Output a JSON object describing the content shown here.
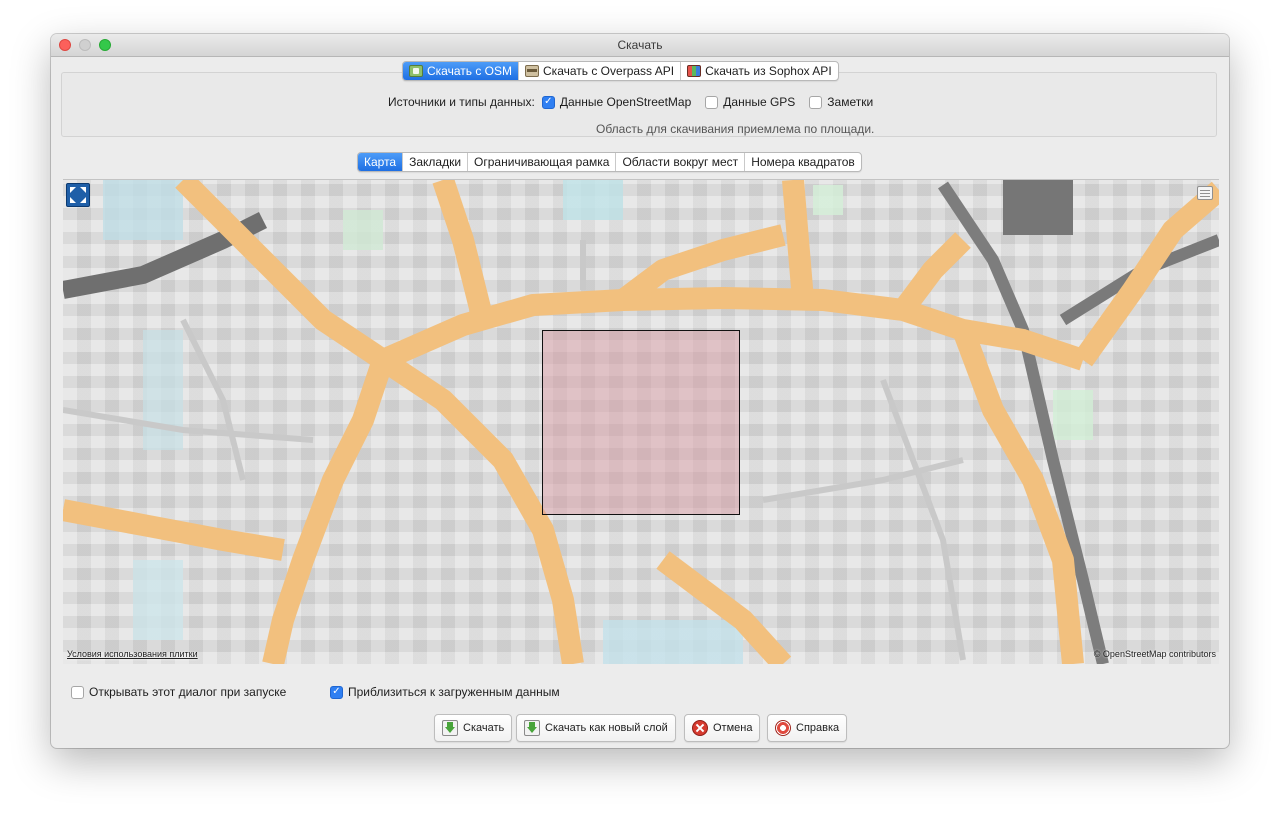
{
  "window": {
    "title": "Скачать"
  },
  "source_tabs": [
    {
      "label": "Скачать с OSM",
      "icon": "osm-download-icon",
      "selected": true
    },
    {
      "label": "Скачать с Overpass API",
      "icon": "overpass-icon",
      "selected": false
    },
    {
      "label": "Скачать из Sophox API",
      "icon": "sophox-icon",
      "selected": false
    }
  ],
  "sources": {
    "label": "Источники и типы данных:",
    "options": [
      {
        "label": "Данные OpenStreetMap",
        "checked": true
      },
      {
        "label": "Данные GPS",
        "checked": false
      },
      {
        "label": "Заметки",
        "checked": false
      }
    ],
    "area_note": "Область для скачивания приемлема по площади."
  },
  "map_tabs": [
    {
      "label": "Карта",
      "selected": true
    },
    {
      "label": "Закладки",
      "selected": false
    },
    {
      "label": "Ограничивающая рамка",
      "selected": false
    },
    {
      "label": "Области вокруг мест",
      "selected": false
    },
    {
      "label": "Номера квадратов",
      "selected": false
    }
  ],
  "map": {
    "terms_link": "Условия использования плитки",
    "attribution": "© OpenStreetMap contributors",
    "expand_icon": "expand-arrows-icon",
    "layer_icon": "layer-list-icon"
  },
  "options": {
    "open_on_startup": {
      "label": "Открывать этот диалог при запуске",
      "checked": false
    },
    "zoom_to_data": {
      "label": "Приблизиться к загруженным данным",
      "checked": true
    }
  },
  "buttons": {
    "download": "Скачать",
    "download_new_layer": "Скачать как новый слой",
    "cancel": "Отмена",
    "help": "Справка"
  },
  "colors": {
    "accent": "#2f7ff2",
    "road": "#f2c07e",
    "selection": "#d89ca4"
  }
}
